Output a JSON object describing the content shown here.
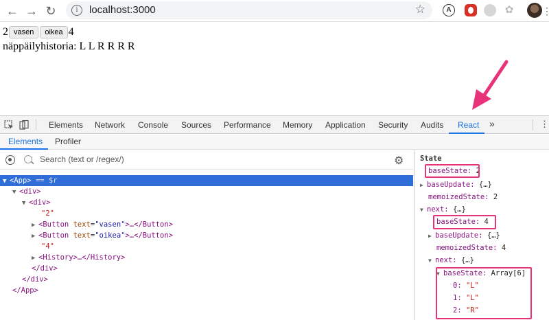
{
  "browser": {
    "url": "localhost:3000"
  },
  "page": {
    "left_count": "2",
    "left_button": "vasen",
    "right_button": "oikea",
    "right_count": "4",
    "history_label": "näppäilyhistoria: L L R R R R"
  },
  "devtools": {
    "tabs": [
      "Elements",
      "Network",
      "Console",
      "Sources",
      "Performance",
      "Memory",
      "Application",
      "Security",
      "Audits",
      "React"
    ],
    "more": "»",
    "react_tabs": [
      "Elements",
      "Profiler"
    ],
    "search_placeholder": "Search (text or /regex/)",
    "tree": {
      "root": "<App>",
      "root_hint": "== $r",
      "div1": "<div>",
      "div2": "<div>",
      "str2": "\"2\"",
      "btn1_open": "<Button",
      "btn1_attr": "text",
      "btn1_val": "\"vasen\"",
      "btn1_close": ">…</Button>",
      "btn2_open": "<Button",
      "btn2_attr": "text",
      "btn2_val": "\"oikea\"",
      "btn2_close": ">…</Button>",
      "str4": "\"4\"",
      "history": "<History>…</History>",
      "div2_close": "</div>",
      "div1_close": "</div>",
      "root_close": "</App>"
    },
    "state": {
      "title": "State",
      "baseState_key": "baseState:",
      "baseState_val": "2",
      "baseUpdate_key": "baseUpdate:",
      "baseUpdate_val": "{…}",
      "memoized_key": "memoizedState:",
      "memoized_val": "2",
      "next_key": "next:",
      "next_val": "{…}",
      "n_baseState_val": "4",
      "n_memoized_val": "4",
      "array_val": "Array[6]",
      "items": [
        {
          "k": "0:",
          "v": "\"L\""
        },
        {
          "k": "1:",
          "v": "\"L\""
        },
        {
          "k": "2:",
          "v": "\"R\""
        }
      ]
    }
  },
  "colors": {
    "highlight": "#e8337a",
    "selection": "#2f6ed9",
    "active_tab": "#1a73e8"
  }
}
